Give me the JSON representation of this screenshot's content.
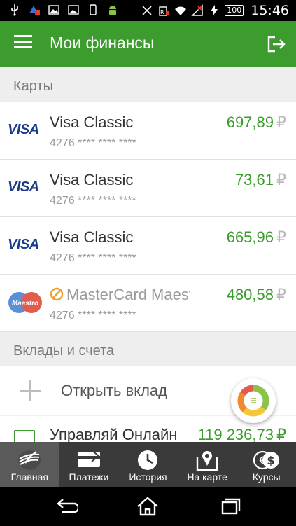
{
  "status_bar": {
    "time": "15:46",
    "battery": "100",
    "left_icons": [
      "usb-icon",
      "notification-icon",
      "image-icon",
      "gallery-icon",
      "phone-icon",
      "android-icon"
    ],
    "right_icons": [
      "vibrate-off-icon",
      "signal-icon",
      "wifi-icon",
      "no-signal-icon",
      "charging-icon"
    ]
  },
  "app_bar": {
    "title": "Мои финансы",
    "menu_icon": "menu-icon",
    "logout_icon": "logout-icon"
  },
  "sections": {
    "cards": "Карты",
    "deposits": "Вклады и счета"
  },
  "cards": [
    {
      "logo": "VISA",
      "name": "Visa Classic",
      "number": "4276 **** **** ****",
      "amount": "697,89",
      "currency": "₽"
    },
    {
      "logo": "VISA",
      "name": "Visa Classic",
      "number": "4276 **** **** ****",
      "amount": "73,61",
      "currency": "₽"
    },
    {
      "logo": "VISA",
      "name": "Visa Classic",
      "number": "4276 **** **** ****",
      "amount": "665,96",
      "currency": "₽"
    },
    {
      "logo": "Maestro",
      "name": "MasterCard Maestro",
      "number": "4276 **** **** ****",
      "amount": "480,58",
      "currency": "₽"
    }
  ],
  "open_deposit": {
    "label": "Открыть вклад"
  },
  "account": {
    "name": "Управляй Онлайн",
    "amount": "119 236,73",
    "currency": "₽"
  },
  "bottom_nav": [
    {
      "label": "Главная",
      "icon": "sberbank-logo-icon",
      "active": true
    },
    {
      "label": "Платежи",
      "icon": "card-icon",
      "active": false
    },
    {
      "label": "История",
      "icon": "clock-icon",
      "active": false
    },
    {
      "label": "На карте",
      "icon": "map-pin-icon",
      "active": false
    },
    {
      "label": "Курсы",
      "icon": "currency-icon",
      "active": false
    }
  ],
  "colors": {
    "brand_green": "#3c9c2e",
    "amount_green": "#3c9c2e",
    "visa_blue": "#1a3a8c",
    "nav_bg": "#3a3a3a"
  }
}
